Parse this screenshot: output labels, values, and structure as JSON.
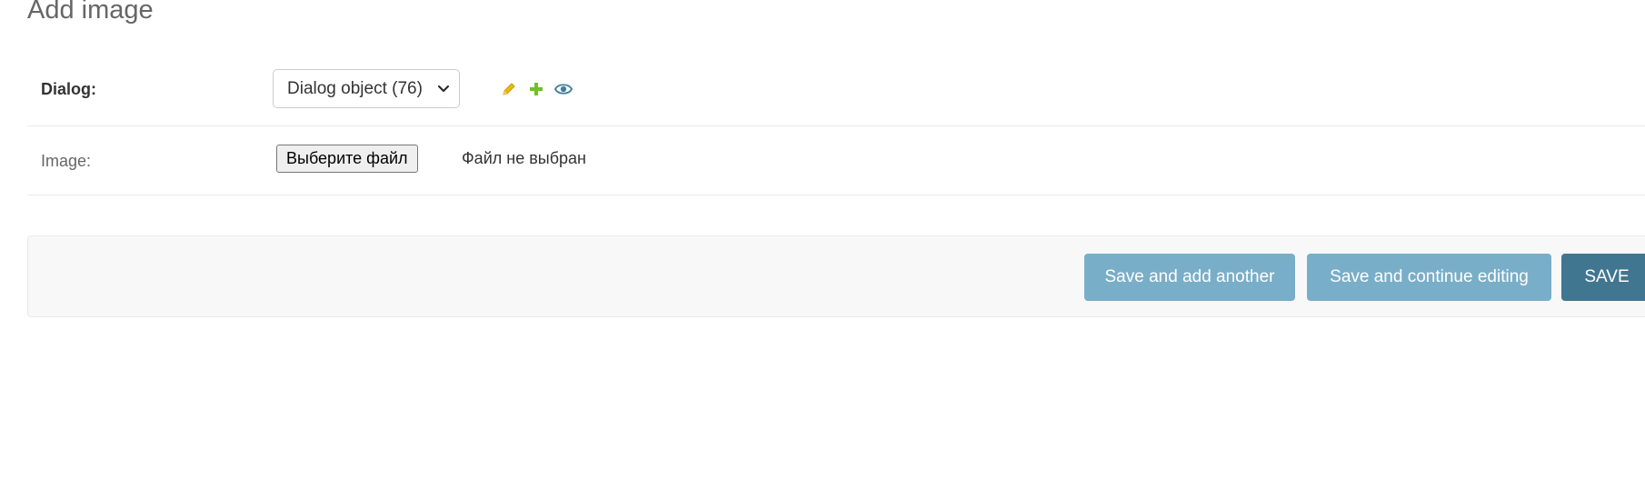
{
  "page": {
    "title": "Add image"
  },
  "form": {
    "dialog": {
      "label": "Dialog:",
      "selected_value": "Dialog object (76)",
      "related_icons": [
        "pencil-icon",
        "plus-icon",
        "eye-icon"
      ]
    },
    "image": {
      "label": "Image:",
      "choose_button": "Выберите файл",
      "status": "Файл не выбран"
    }
  },
  "actions": {
    "save_add_another": "Save and add another",
    "save_continue": "Save and continue editing",
    "save": "SAVE"
  },
  "colors": {
    "secondary_button": "#79aec8",
    "primary_button": "#417690",
    "edit_icon": "#efb80b",
    "add_icon": "#70bf2b",
    "view_icon": "#447e9b"
  }
}
